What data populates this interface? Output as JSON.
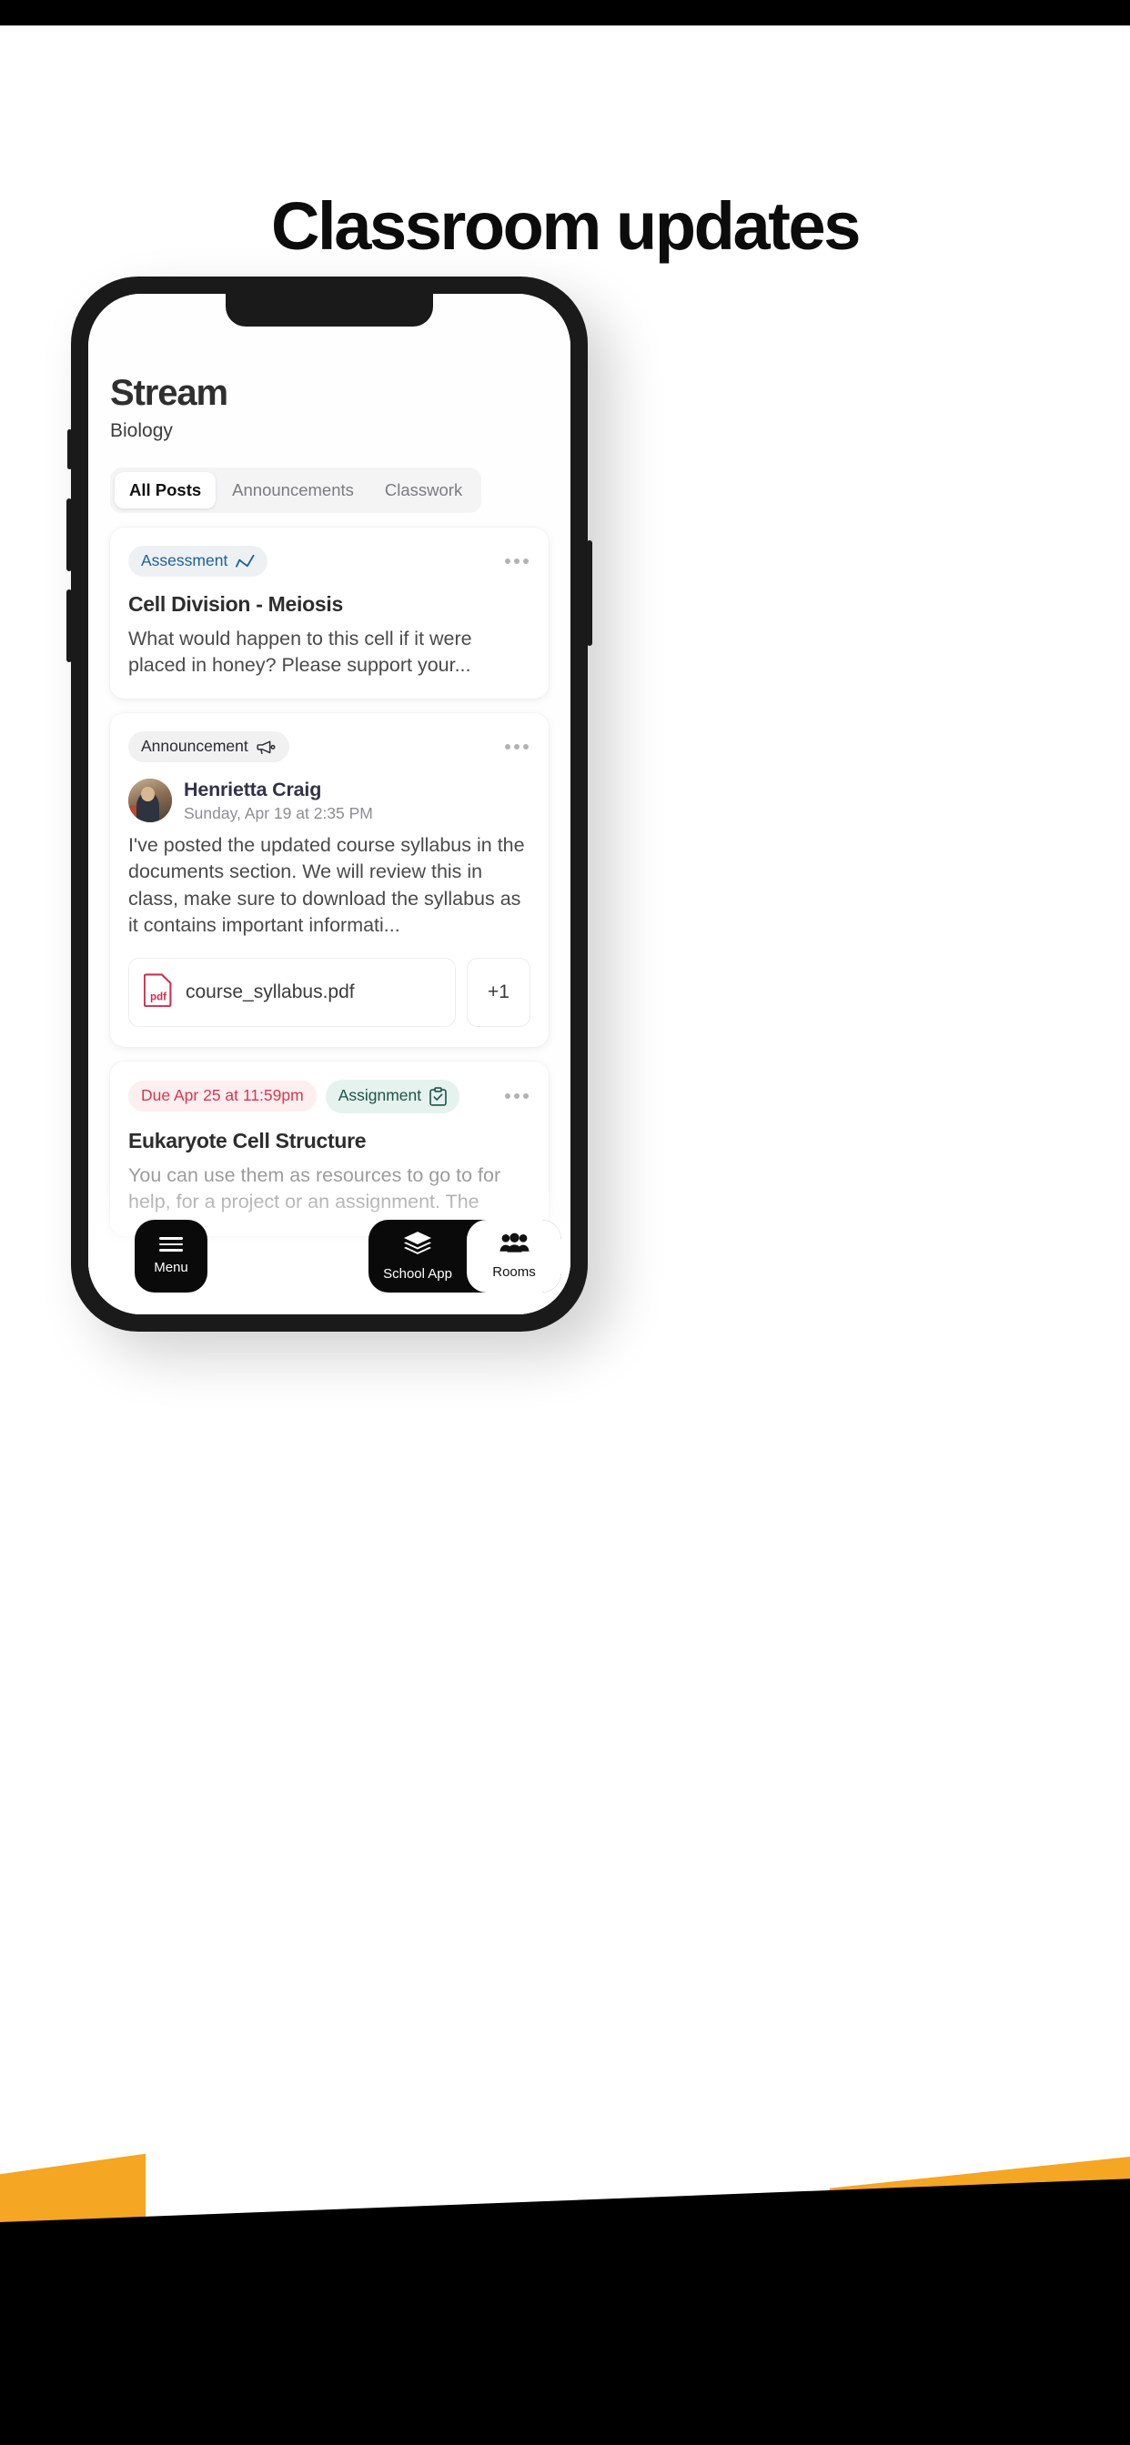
{
  "poster": {
    "headline": "Classroom updates",
    "background_color": "#ffffff",
    "frame_color": "#000000",
    "accent_color": "#F5A623"
  },
  "app": {
    "title": "Stream",
    "subtitle": "Biology",
    "tabs": [
      {
        "label": "All Posts",
        "active": true
      },
      {
        "label": "Announcements",
        "active": false
      },
      {
        "label": "Classwork",
        "active": false
      }
    ],
    "posts": [
      {
        "chip": {
          "label": "Assessment",
          "icon": "trend-chart-icon",
          "text_color": "#1f5f96",
          "bg_color": "#eef1f4"
        },
        "title": "Cell Division - Meiosis",
        "body": "What would happen to this cell if it were placed in honey? Please support your...",
        "overflow_menu": "more-options-icon"
      },
      {
        "chip": {
          "label": "Announcement",
          "icon": "megaphone-icon",
          "text_color": "#2b2b2e",
          "bg_color": "#f1f1f2"
        },
        "author": {
          "name": "Henrietta Craig",
          "timestamp": "Sunday, Apr 19 at 2:35 PM",
          "avatar": "teacher-photo"
        },
        "body": "I've posted the updated course syllabus in the documents section. We will review this in class, make sure to download the syllabus as it contains important informati...",
        "attachments": [
          {
            "name": "course_syllabus.pdf",
            "type": "pdf",
            "icon_color": "#cc2f4f"
          }
        ],
        "more_attachments_label": "+1",
        "overflow_menu": "more-options-icon"
      },
      {
        "due_chip": {
          "label": "Due Apr 25 at 11:59pm",
          "text_color": "#d33a50",
          "bg_color": "#fdeef0"
        },
        "chip": {
          "label": "Assignment",
          "icon": "clipboard-check-icon",
          "text_color": "#1d5446",
          "bg_color": "#e6f2ee"
        },
        "title": "Eukaryote Cell Structure",
        "body": "You can use them as resources to go to for help, for a project or an assignment. The",
        "overflow_menu": "more-options-icon"
      }
    ],
    "bottom_nav": {
      "menu": {
        "label": "Menu",
        "icon": "hamburger-icon"
      },
      "items": [
        {
          "label": "School App",
          "icon": "layers-icon",
          "active": false
        },
        {
          "label": "Rooms",
          "icon": "people-group-icon",
          "active": true
        }
      ]
    }
  }
}
